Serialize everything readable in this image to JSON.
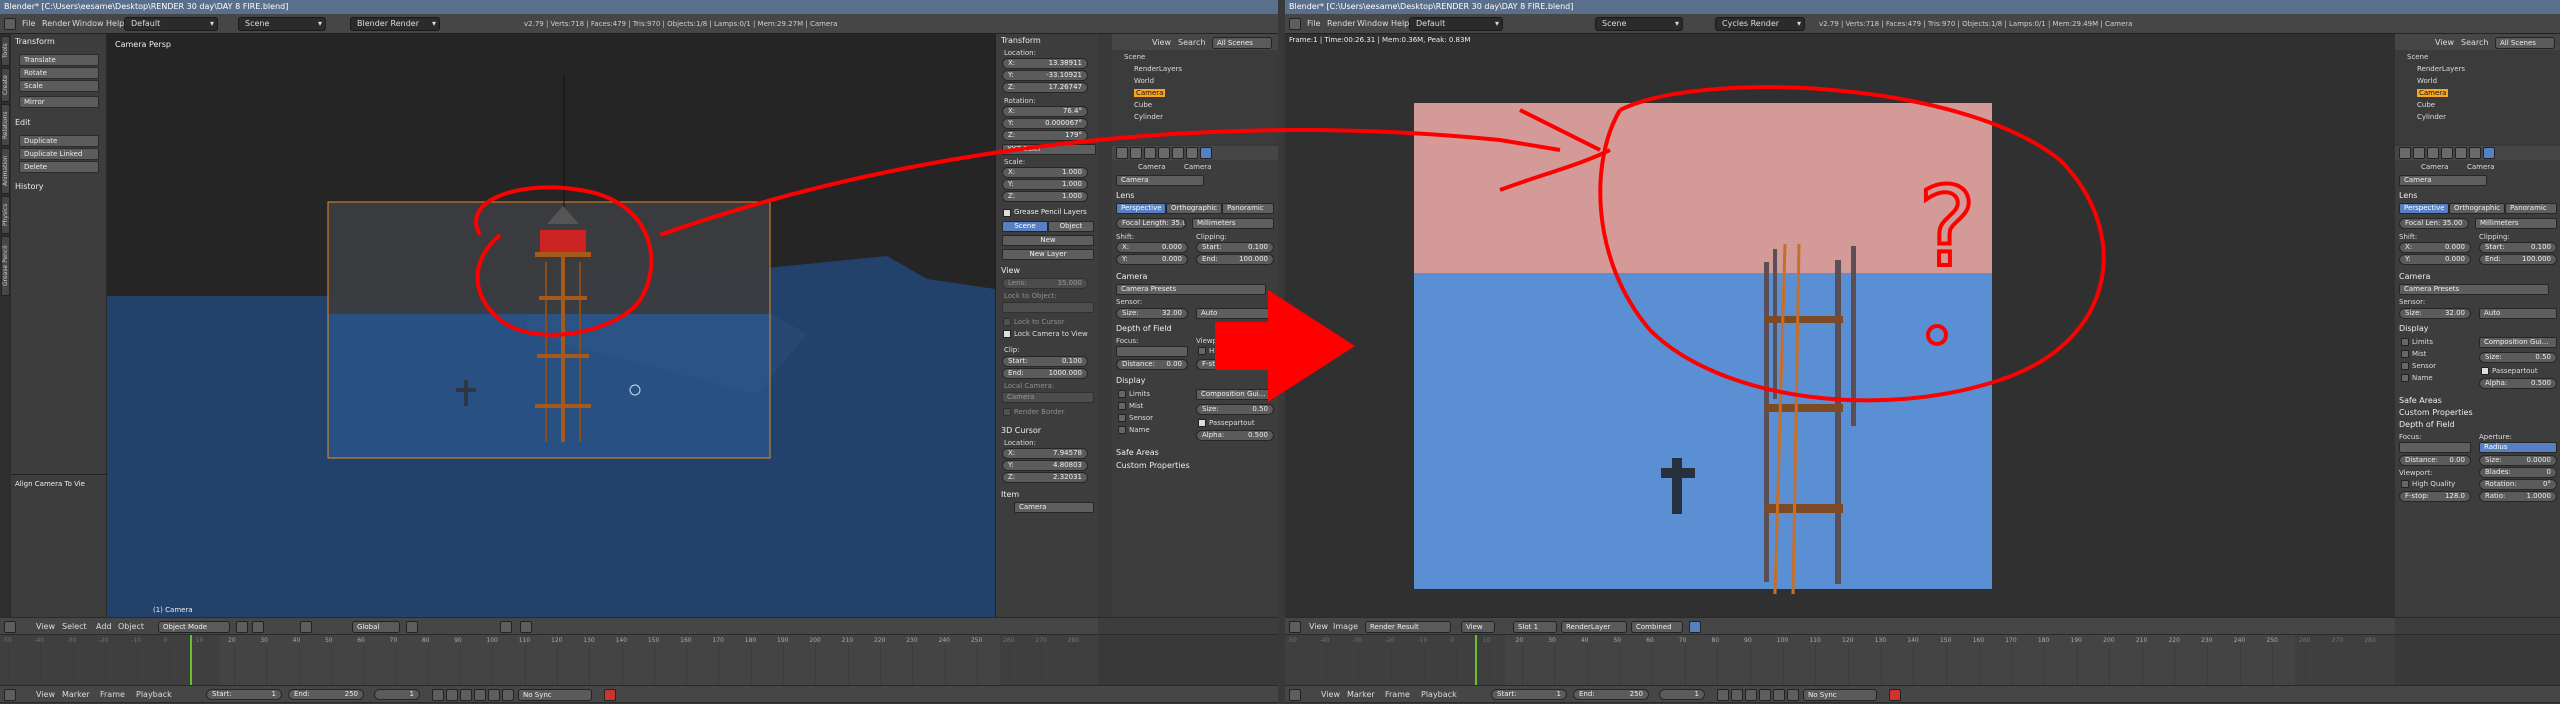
{
  "left": {
    "title": "Blender* [C:\\Users\\eesame\\Desktop\\RENDER 30 day\\DAY 8 FIRE.blend]",
    "menu": [
      "File",
      "Render",
      "Window",
      "Help"
    ],
    "layout": "Default",
    "scene": "Scene",
    "engine": "Blender Render",
    "stats": "v2.79 | Verts:718 | Faces:479 | Tris:970 | Objects:1/8 | Lamps:0/1 | Mem:29.27M | Camera",
    "tool_shelf": {
      "transform_title": "Transform",
      "transform": [
        "Translate",
        "Rotate",
        "Scale",
        "Mirror"
      ],
      "edit_title": "Edit",
      "edit": [
        "Duplicate",
        "Duplicate Linked",
        "Delete"
      ],
      "history_title": "History",
      "operator": "Align Camera To Vie",
      "tabs": [
        "Tools",
        "Create",
        "Relations",
        "Animation",
        "Physics",
        "Grease Pencil"
      ]
    },
    "viewport": {
      "label": "Camera Persp",
      "object_label": "(1) Camera"
    },
    "properties": {
      "transform_title": "Transform",
      "location_label": "Location:",
      "location": [
        {
          "axis": "X:",
          "value": "13.38911"
        },
        {
          "axis": "Y:",
          "value": "-33.10921"
        },
        {
          "axis": "Z:",
          "value": "17.26747"
        }
      ],
      "rotation_label": "Rotation:",
      "rotation": [
        {
          "axis": "X:",
          "value": "76.4°"
        },
        {
          "axis": "Y:",
          "value": "0.000067°"
        },
        {
          "axis": "Z:",
          "value": "179°"
        }
      ],
      "rotation_mode": "XYZ Euler",
      "scale_label": "Scale:",
      "scale": [
        {
          "axis": "X:",
          "value": "1.000"
        },
        {
          "axis": "Y:",
          "value": "1.000"
        },
        {
          "axis": "Z:",
          "value": "1.000"
        }
      ],
      "grease_title": "Grease Pencil Layers",
      "grease_tabs": [
        "Scene",
        "Object"
      ],
      "grease_new": "New",
      "grease_new_layer": "New Layer",
      "view_title": "View",
      "lens_label": "Lens:",
      "lens_value": "35.000",
      "lock_object": "Lock to Object:",
      "lock_cursor": "Lock to Cursor",
      "lock_camera": "Lock Camera to View",
      "clip_label": "Clip:",
      "clip_start": {
        "label": "Start:",
        "value": "0.100"
      },
      "clip_end": {
        "label": "End:",
        "value": "1000.000"
      },
      "local_camera": "Local Camera:",
      "local_camera_value": "Camera",
      "render_border": "Render Border",
      "cursor_title": "3D Cursor",
      "cursor_location_label": "Location:",
      "cursor": [
        {
          "axis": "X:",
          "value": "7.94578"
        },
        {
          "axis": "Y:",
          "value": "4.80803"
        },
        {
          "axis": "Z:",
          "value": "2.32031"
        }
      ],
      "item_title": "Item",
      "item_value": "Camera"
    },
    "outliner": {
      "top": [
        "View",
        "Search",
        "All Scenes"
      ],
      "items": [
        "Scene",
        "RenderLayers",
        "World",
        "Camera",
        "Cube",
        "Cylinder"
      ]
    },
    "camera_props": {
      "breadcrumb": [
        "Camera",
        "Camera"
      ],
      "name": "Camera",
      "lens_title": "Lens",
      "lens_tabs": [
        "Perspective",
        "Orthographic",
        "Panoramic"
      ],
      "focal": "Focal Length: 35.00",
      "focal_unit": "Millimeters",
      "shift_label": "Shift:",
      "shift": [
        {
          "axis": "X:",
          "value": "0.000"
        },
        {
          "axis": "Y:",
          "value": "0.000"
        }
      ],
      "clipping_label": "Clipping:",
      "clipping": [
        {
          "axis": "Start:",
          "value": "0.100"
        },
        {
          "axis": "End:",
          "value": "100.000"
        }
      ],
      "camera_title": "Camera",
      "presets": "Camera Presets",
      "sensor_label": "Sensor:",
      "sensor_size": "Size:",
      "sensor_value": "32.00",
      "sensor_fit": "Auto",
      "dof_title": "Depth of Field",
      "focus_label": "Focus:",
      "distance_label": "Distance:",
      "distance_value": "0.00",
      "viewport_label": "Viewport:",
      "high_quality": "High Quality",
      "fstop_label": "F-stop:",
      "fstop_value": "128.0",
      "display_title": "Display",
      "display_left": [
        "Limits",
        "Mist",
        "Sensor",
        "Name"
      ],
      "composition": "Composition Gui...",
      "display_size_label": "Size:",
      "display_size": "0.50",
      "passepartout": "Passepartout",
      "alpha_label": "Alpha:",
      "alpha": "0.500",
      "safe_areas": "Safe Areas",
      "custom": "Custom Properties"
    },
    "header3d": {
      "menus": [
        "View",
        "Select",
        "Add",
        "Object"
      ],
      "mode": "Object Mode",
      "orientation": "Global"
    },
    "timeline": {
      "ticks": [
        "-50",
        "-40",
        "-30",
        "-20",
        "-10",
        "0",
        "10",
        "20",
        "30",
        "40",
        "50",
        "60",
        "70",
        "80",
        "90",
        "100",
        "110",
        "120",
        "130",
        "140",
        "150",
        "160",
        "170",
        "180",
        "190",
        "200",
        "210",
        "220",
        "230",
        "240",
        "250",
        "260",
        "270",
        "280"
      ],
      "menus": [
        "View",
        "Marker",
        "Frame",
        "Playback"
      ],
      "start": "Start:",
      "start_value": "1",
      "end": "End:",
      "end_value": "250",
      "current": "1",
      "sync": "No Sync"
    }
  },
  "right": {
    "title": "Blender* [C:\\Users\\eesame\\Desktop\\RENDER 30 day\\DAY 8 FIRE.blend]",
    "menu": [
      "File",
      "Render",
      "Window",
      "Help"
    ],
    "layout": "Default",
    "scene": "Scene",
    "engine": "Cycles Render",
    "stats": "v2.79 | Verts:718 | Faces:479 | Tris:970 | Objects:1/8 | Lamps:0/1 | Mem:29.49M | Camera",
    "render_info": "Frame:1 | Time:00:26.31 | Mem:0.36M, Peak: 0.83M",
    "image_header": {
      "menus": [
        "View",
        "Image"
      ],
      "image": "Render Result",
      "view": "View",
      "slot": "Slot 1",
      "layer": "RenderLayer",
      "pass": "Combined"
    },
    "outliner": {
      "top": [
        "View",
        "Search",
        "All Scenes"
      ],
      "items": [
        "Scene",
        "RenderLayers",
        "World",
        "Camera",
        "Cube",
        "Cylinder"
      ]
    },
    "camera_props": {
      "breadcrumb": [
        "Camera",
        "Camera"
      ],
      "name": "Camera",
      "lens_title": "Lens",
      "lens_tabs": [
        "Perspective",
        "Orthographic",
        "Panoramic"
      ],
      "focal": "Focal Len: 35.00",
      "focal_unit": "Millimeters",
      "shift_label": "Shift:",
      "shift": [
        {
          "axis": "X:",
          "value": "0.000"
        },
        {
          "axis": "Y:",
          "value": "0.000"
        }
      ],
      "clipping_label": "Clipping:",
      "clipping": [
        {
          "axis": "Start:",
          "value": "0.100"
        },
        {
          "axis": "End:",
          "value": "100.000"
        }
      ],
      "camera_title": "Camera",
      "presets": "Camera Presets",
      "sensor_label": "Sensor:",
      "sensor_size": "Size:",
      "sensor_value": "32.00",
      "sensor_fit": "Auto",
      "display_title": "Display",
      "display_left": [
        "Limits",
        "Mist",
        "Sensor",
        "Name"
      ],
      "composition": "Composition Gui...",
      "display_size_label": "Size:",
      "display_size": "0.50",
      "passepartout": "Passepartout",
      "alpha_label": "Alpha:",
      "alpha": "0.500",
      "safe_areas": "Safe Areas",
      "custom": "Custom Properties",
      "dof_title": "Depth of Field",
      "focus_label": "Focus:",
      "distance_label": "Distance:",
      "distance_value": "0.00",
      "aperture_label": "Aperture:",
      "aperture_type": "Radius",
      "aperture_size_label": "Size:",
      "aperture_size": "0.0000",
      "blades_label": "Blades:",
      "blades": "0",
      "rotation_label": "Rotation:",
      "rotation": "0°",
      "ratio_label": "Ratio:",
      "ratio": "1.0000",
      "viewport_label": "Viewport:",
      "high_quality": "High Quality",
      "fstop_label": "F-stop:",
      "fstop_value": "128.0"
    },
    "timeline": {
      "ticks": [
        "-50",
        "-40",
        "-30",
        "-20",
        "-10",
        "0",
        "10",
        "20",
        "30",
        "40",
        "50",
        "60",
        "70",
        "80",
        "90",
        "100",
        "110",
        "120",
        "130",
        "140",
        "150",
        "160",
        "170",
        "180",
        "190",
        "200",
        "210",
        "220",
        "230",
        "240",
        "250",
        "260",
        "270",
        "280"
      ],
      "menus": [
        "View",
        "Marker",
        "Frame",
        "Playback"
      ],
      "start": "Start:",
      "start_value": "1",
      "end": "End:",
      "end_value": "250",
      "current": "1",
      "sync": "No Sync"
    }
  },
  "annotation": {
    "question_mark": "?",
    "color": "#ff0000"
  }
}
